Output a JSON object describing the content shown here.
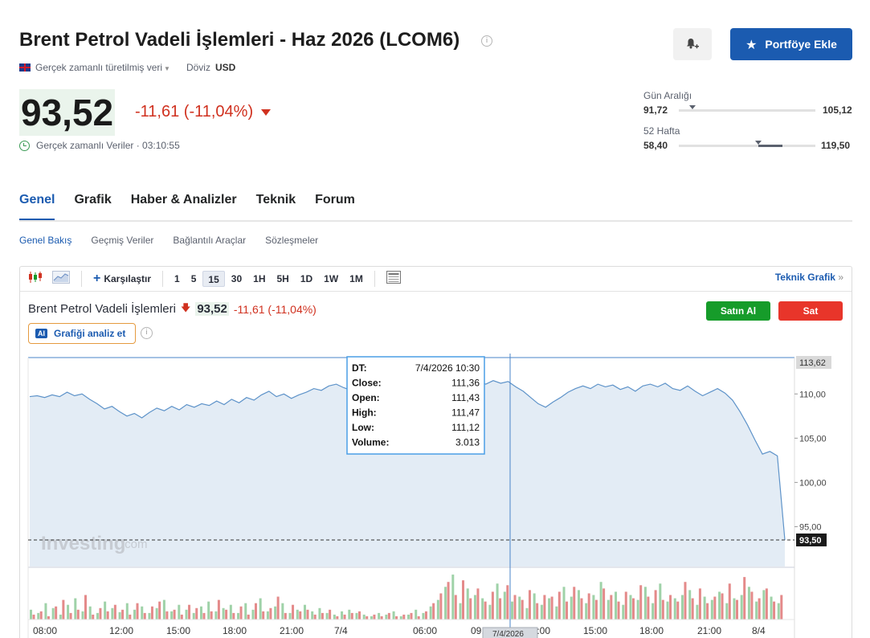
{
  "header": {
    "title": "Brent Petrol Vadeli İşlemleri - Haz 2026 (LCOM6)",
    "data_source": "Gerçek zamanlı türetilmiş veri",
    "currency_label": "Döviz",
    "currency": "USD",
    "portfolio_button": "Portföye Ekle"
  },
  "quote": {
    "price": "93,52",
    "change": "-11,61 (-11,04%)",
    "realtime_label": "Gerçek zamanlı Veriler · 03:10:55",
    "price_bg": "#eaf4ec",
    "down_color": "#d0311f"
  },
  "ranges": {
    "day": {
      "label": "Gün Aralığı",
      "low": "91,72",
      "high": "105,12",
      "position": 0.1
    },
    "week52": {
      "label": "52 Hafta",
      "low": "58,40",
      "high": "119,50",
      "position": 0.58,
      "fill_start": 0.58,
      "fill_end": 0.76
    }
  },
  "tabs": [
    "Genel",
    "Grafik",
    "Haber & Analizler",
    "Teknik",
    "Forum"
  ],
  "subtabs": [
    "Genel Bakış",
    "Geçmiş Veriler",
    "Bağlantılı Araçlar",
    "Sözleşmeler"
  ],
  "toolbar": {
    "compare": "Karşılaştır",
    "intervals": [
      "1",
      "5",
      "15",
      "30",
      "1H",
      "5H",
      "1D",
      "1W",
      "1M"
    ],
    "selected_interval": "15",
    "technical_chart": "Teknik Grafik"
  },
  "chart_header": {
    "name": "Brent Petrol Vadeli İşlemleri",
    "price": "93,52",
    "change": "-11,61 (-11,04%)",
    "ai_badge": "AI",
    "analyze_button": "Grafiği analiz et",
    "buy_button": "Satın Al",
    "sell_button": "Sat",
    "buy_color": "#169c2a",
    "sell_color": "#e8352a"
  },
  "tooltip": {
    "rows": [
      [
        "DT:",
        "7/4/2026 10:30"
      ],
      [
        "Close:",
        "111,36"
      ],
      [
        "Open:",
        "111,43"
      ],
      [
        "High:",
        "111,47"
      ],
      [
        "Low:",
        "111,12"
      ],
      [
        "Volume:",
        "3.013"
      ]
    ],
    "crosshair_date": "7/4/2026"
  },
  "watermark": "Investing",
  "watermark_suffix": ".com",
  "chart_data": {
    "type": "area",
    "y_ticks": [
      "110,00",
      "105,00",
      "100,00",
      "95,00"
    ],
    "y_tick_values": [
      110,
      105,
      100,
      95
    ],
    "ylim": [
      90.5,
      114.2
    ],
    "top_label": "113,62",
    "last_label": "93,50",
    "last_value": 93.5,
    "x_labels": [
      "08:00",
      "12:00",
      "15:00",
      "18:00",
      "21:00",
      "7/4",
      "06:00",
      "09:00",
      "12:00",
      "15:00",
      "18:00",
      "21:00",
      "8/4"
    ],
    "series": [
      {
        "values": [
          109.7,
          109.8,
          109.6,
          109.9,
          109.7,
          110.2,
          109.8,
          110.0,
          109.4,
          108.9,
          108.3,
          108.6,
          108.0,
          107.5,
          107.8,
          107.3,
          107.9,
          108.4,
          108.1,
          108.6,
          108.2,
          108.8,
          108.5,
          108.9,
          108.7,
          109.2,
          108.8,
          109.4,
          109.0,
          109.6,
          109.3,
          109.9,
          110.3,
          109.7,
          110.0,
          109.5,
          109.9,
          110.2,
          110.6,
          110.4,
          110.9,
          111.1,
          110.7,
          110.4,
          110.0,
          109.6,
          110.1,
          109.8,
          110.2,
          110.0,
          109.7,
          110.3,
          110.6,
          110.4,
          110.9,
          110.6,
          111.0,
          110.7,
          111.2,
          110.9,
          111.4,
          111.1,
          111.5,
          111.2,
          111.4,
          110.8,
          110.3,
          109.6,
          108.9,
          108.5,
          109.1,
          109.6,
          110.2,
          110.6,
          110.9,
          110.6,
          111.1,
          110.8,
          111.0,
          110.5,
          110.8,
          110.3,
          110.9,
          111.1,
          110.8,
          111.2,
          110.6,
          110.4,
          110.9,
          110.3,
          109.8,
          110.2,
          110.6,
          110.1,
          109.3,
          108.0,
          106.5,
          104.8,
          103.2,
          103.5,
          103.0,
          93.5
        ],
        "volume_buy": [
          12,
          8,
          20,
          14,
          6,
          18,
          26,
          10,
          16,
          8,
          22,
          14,
          9,
          20,
          12,
          16,
          8,
          14,
          24,
          10,
          18,
          12,
          8,
          16,
          22,
          10,
          14,
          18,
          8,
          20,
          12,
          26,
          10,
          16,
          20,
          8,
          12,
          18,
          10,
          14,
          8,
          6,
          10,
          12,
          8,
          6,
          4,
          8,
          6,
          10,
          4,
          6,
          12,
          8,
          16,
          24,
          40,
          55,
          20,
          38,
          30,
          26,
          18,
          44,
          34,
          22,
          28,
          14,
          32,
          18,
          26,
          16,
          40,
          28,
          36,
          20,
          30,
          46,
          24,
          34,
          18,
          30,
          24,
          40,
          20,
          44,
          22,
          26,
          30,
          36,
          18,
          28,
          24,
          34,
          20,
          26,
          30,
          40,
          22,
          36,
          28,
          20
        ],
        "volume_sell": [
          6,
          10,
          4,
          16,
          24,
          8,
          12,
          30,
          6,
          14,
          10,
          18,
          12,
          6,
          20,
          8,
          16,
          22,
          10,
          12,
          6,
          18,
          14,
          8,
          10,
          24,
          12,
          8,
          16,
          6,
          20,
          10,
          14,
          28,
          8,
          18,
          10,
          12,
          6,
          8,
          12,
          4,
          6,
          8,
          10,
          4,
          6,
          4,
          8,
          4,
          6,
          8,
          4,
          10,
          20,
          32,
          46,
          30,
          48,
          26,
          38,
          22,
          34,
          26,
          42,
          30,
          24,
          36,
          20,
          30,
          28,
          34,
          22,
          40,
          26,
          32,
          24,
          38,
          30,
          22,
          34,
          26,
          42,
          28,
          36,
          24,
          30,
          22,
          46,
          26,
          38,
          20,
          28,
          32,
          44,
          24,
          52,
          34,
          26,
          38,
          22,
          30
        ]
      }
    ]
  }
}
